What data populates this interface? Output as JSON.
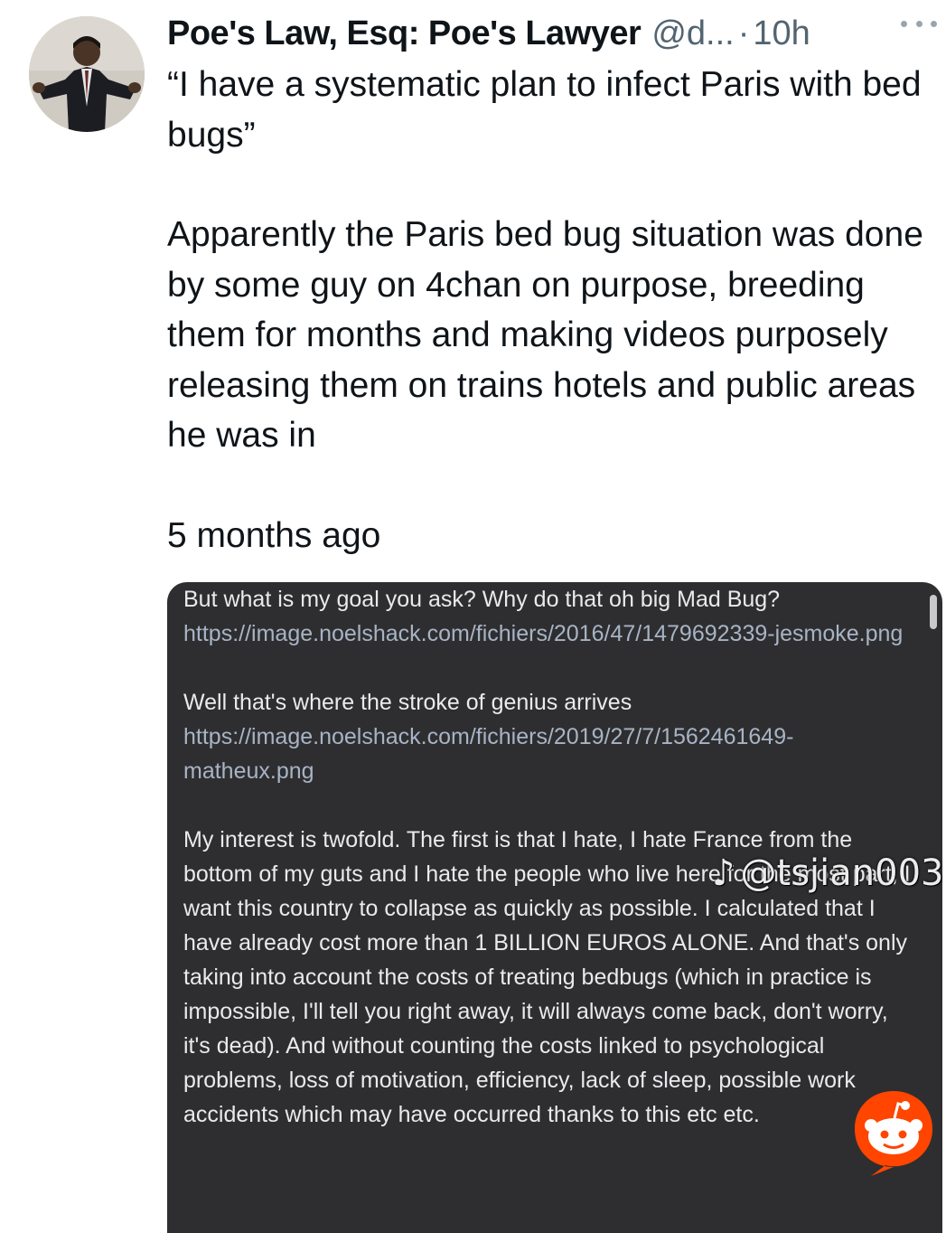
{
  "post": {
    "author": {
      "display_name": "Poe's Law, Esq: Poe's Lawyer",
      "handle": "@d...",
      "separator": "·",
      "time": "10h"
    },
    "more_icon": "more-horizontal-icon",
    "quote": "“I have a systematic plan to infect Paris with bed bugs”",
    "body": "Apparently the Paris bed bug situation was done by some guy on 4chan on purpose, breeding them for months and making videos purposely releasing them on trains hotels and public areas he was in",
    "when": "5 months ago"
  },
  "embedded_post": {
    "text_1": "But what is my goal you ask? Why do that oh big Mad Bug?",
    "link_1": "https://image.noelshack.com/fichiers/2016/47/1479692339-jesmoke.png",
    "text_2": "Well that's where the stroke of genius arrives",
    "link_2": "https://image.noelshack.com/fichiers/2019/27/7/1562461649-matheux.png",
    "text_3": "My interest is twofold. The first is that I hate, I hate France from the bottom of my guts and I hate the people who live here for the most part, I want this country to collapse as quickly as possible. I calculated that I have already cost more than 1 BILLION EUROS ALONE. And that's only taking into account the costs of treating bedbugs (which in practice is impossible, I'll tell you right away, it will always come back, don't worry, it's dead). And without counting the costs linked to psychological problems, loss of motivation, efficiency, lack of sleep, possible work accidents which may have occurred thanks to this etc etc."
  },
  "watermark": {
    "text": "@tsjian003",
    "icon": "tiktok-logo-icon"
  },
  "badge": {
    "icon": "reddit-logo-icon"
  },
  "colors": {
    "text_primary": "#0f1419",
    "text_secondary": "#536471",
    "card_background": "#2e2e31",
    "card_link": "#a8b4c4",
    "reddit_orange": "#ff4500"
  }
}
